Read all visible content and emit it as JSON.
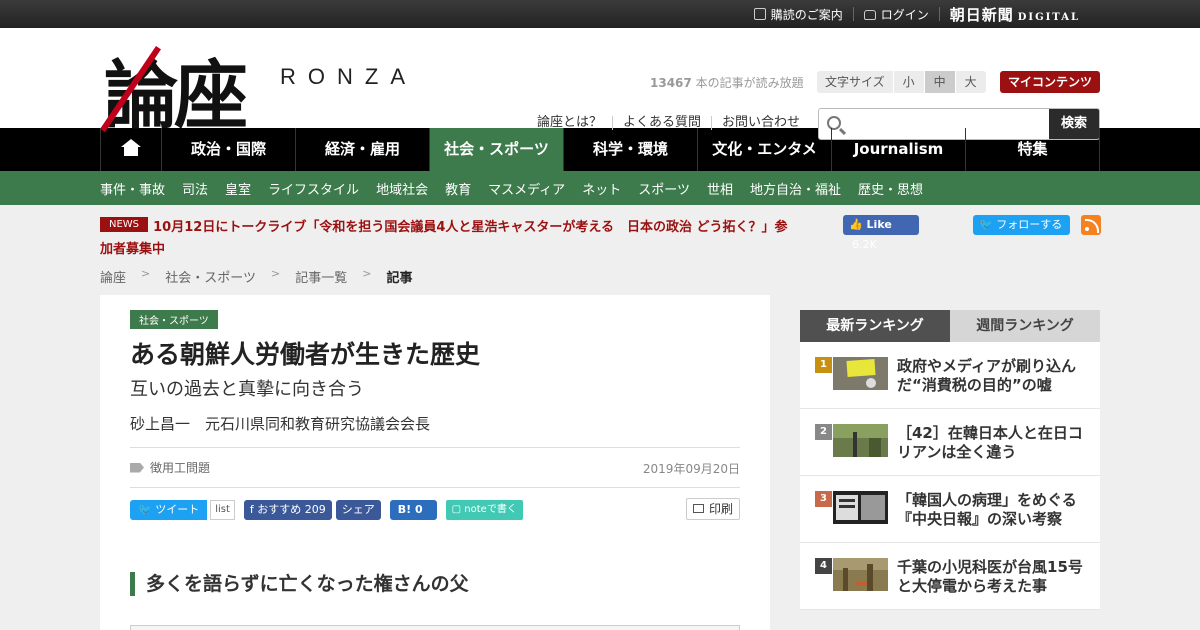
{
  "topbar": {
    "subscribe": "購読のご案内",
    "login": "ログイン",
    "brand": "朝日新聞",
    "brand_sub": "DIGITAL"
  },
  "header": {
    "logo_kanji": "論座",
    "logo_latin": "RONZA",
    "read_count_num": "13467",
    "read_count_text": "本の記事が読み放題",
    "fontsize_label": "文字サイズ",
    "fontsize_small": "小",
    "fontsize_medium": "中",
    "fontsize_large": "大",
    "mycontent": "マイコンテンツ",
    "links": [
      "論座とは？",
      "よくある質問",
      "お問い合わせ"
    ],
    "search_placeholder": "",
    "search_button": "検索"
  },
  "nav": {
    "items": [
      "政治・国際",
      "経済・雇用",
      "社会・スポーツ",
      "科学・環境",
      "文化・エンタメ",
      "Journalism",
      "特集"
    ],
    "active_index": 2
  },
  "subnav": {
    "items": [
      "事件・事故",
      "司法",
      "皇室",
      "ライフスタイル",
      "地域社会",
      "教育",
      "マスメディア",
      "ネット",
      "スポーツ",
      "世相",
      "地方自治・福祉",
      "歴史・思想"
    ]
  },
  "news": {
    "badge": "NEWS",
    "text": "10月12日にトークライブ「令和を担う国会議員4人と星浩キャスターが考える　日本の政治 どう拓く？」参加者募集中"
  },
  "social_top": {
    "fb_like": "Like",
    "fb_count": "6.2K",
    "tw_follow": "フォローする"
  },
  "breadcrumb": [
    "論座",
    "社会・スポーツ",
    "記事一覧",
    "記事"
  ],
  "article": {
    "category": "社会・スポーツ",
    "title": "ある朝鮮人労働者が生きた歴史",
    "subtitle": "互いの過去と真摯に向き合う",
    "author": "砂上昌一　元石川県同和教育研究協議会会長",
    "tag": "徴用工問題",
    "date": "2019年09月20日",
    "share": {
      "tweet": "ツイート",
      "list": "list",
      "fb_recommend": "おすすめ",
      "fb_count": "209",
      "fb_share": "シェア",
      "hatena_count": "0",
      "note": "noteで書く",
      "print": "印刷"
    },
    "heading": "多くを語らずに亡くなった権さんの父"
  },
  "ranking": {
    "tab_latest": "最新ランキング",
    "tab_weekly": "週間ランキング",
    "items": [
      {
        "rank": "1",
        "title": "政府やメディアが刷り込んだ“消費税の目的”の嘘",
        "color": "#c8900f"
      },
      {
        "rank": "2",
        "title": "［42］在韓日本人と在日コリアンは全く違う",
        "color": "#888888"
      },
      {
        "rank": "3",
        "title": "「韓国人の病理」をめぐる『中央日報』の深い考察",
        "color": "#c86a4a"
      },
      {
        "rank": "4",
        "title": "千葉の小児科医が台風15号と大停電から考えた事",
        "color": "#444444"
      }
    ]
  }
}
